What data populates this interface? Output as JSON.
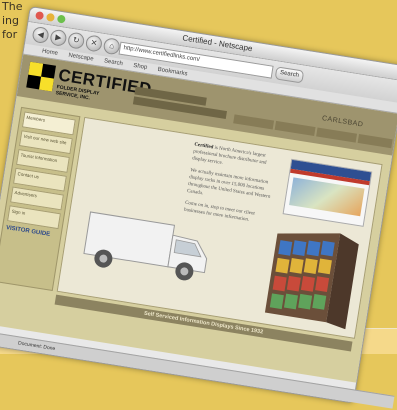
{
  "page_text": [
    "The",
    "ing",
    "for"
  ],
  "browser": {
    "title": "Certified - Netscape",
    "address": "http://www.certifiedlinks.com/",
    "search_label": "Search",
    "bookmarks": [
      "Home",
      "Netscape",
      "Search",
      "Shop",
      "Bookmarks"
    ],
    "status": "Document: Done"
  },
  "site": {
    "logo_big": "CERTIFIED",
    "logo_small": [
      "FOLDER DISPLAY",
      "SERVICE, INC."
    ],
    "location": "CARLSBAD",
    "sidebar_items": [
      "Members",
      "Visit our new web site",
      "Tourist Information",
      "Contact us",
      "Advertisers",
      "Sign in"
    ],
    "sidebar_brand": "VISITOR GUIDE",
    "intro_para1_bold": "Certified",
    "intro_para1": " is North America's largest professional brochure distributor and display service.",
    "intro_para2": "We actually maintain more information display racks in over 15,000 locations throughout the United States and Western Canada.",
    "intro_para3": "Come on in, stop to meet our client businesses for more information.",
    "footer": "Self Serviced Information Displays Since 1932"
  }
}
